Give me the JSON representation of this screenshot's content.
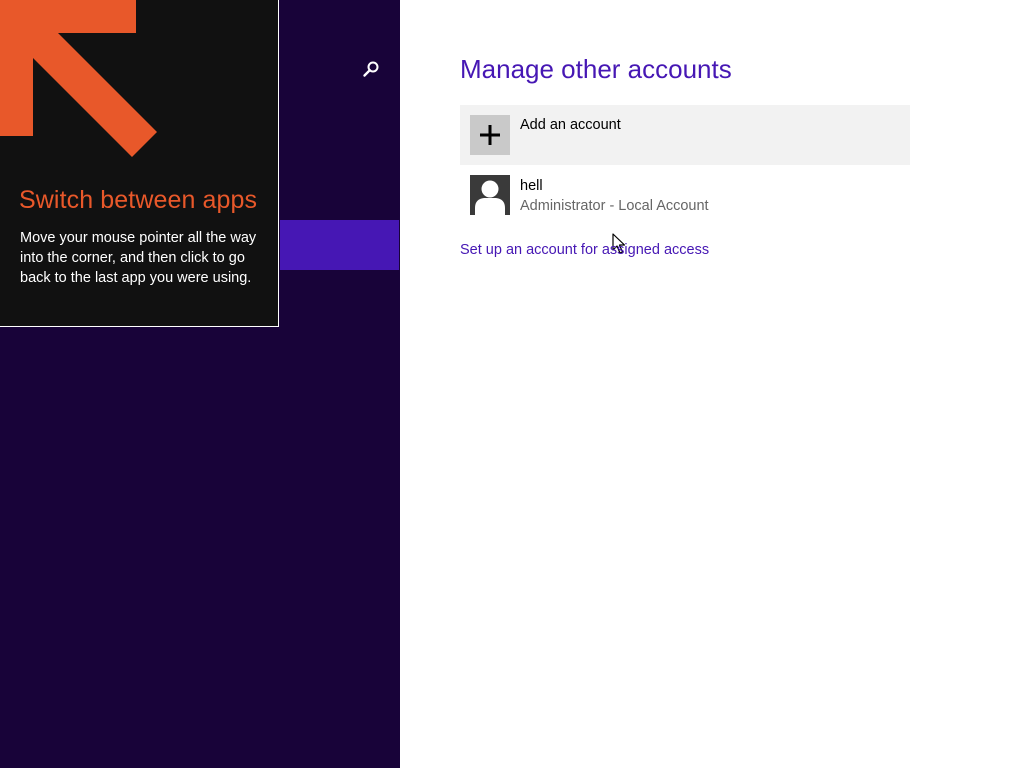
{
  "nav": {
    "search_icon": "search-icon"
  },
  "tip": {
    "title": "Switch between apps",
    "body": "Move your mouse pointer all the way into the corner, and then click to go back to the last app you were using.",
    "arrow_color": "#e8582a"
  },
  "content": {
    "title": "Manage other accounts",
    "add_account": {
      "icon": "plus-icon",
      "label": "Add an account"
    },
    "accounts": [
      {
        "name": "hell",
        "type": "Administrator - Local Account",
        "icon": "user-avatar-icon"
      }
    ],
    "assigned_access_link": "Set up an account for assigned access"
  },
  "colors": {
    "nav_background": "#180339",
    "nav_selected": "#4617b4",
    "accent": "#4617b4",
    "tip_background": "#111111",
    "tip_title": "#e8582a"
  }
}
